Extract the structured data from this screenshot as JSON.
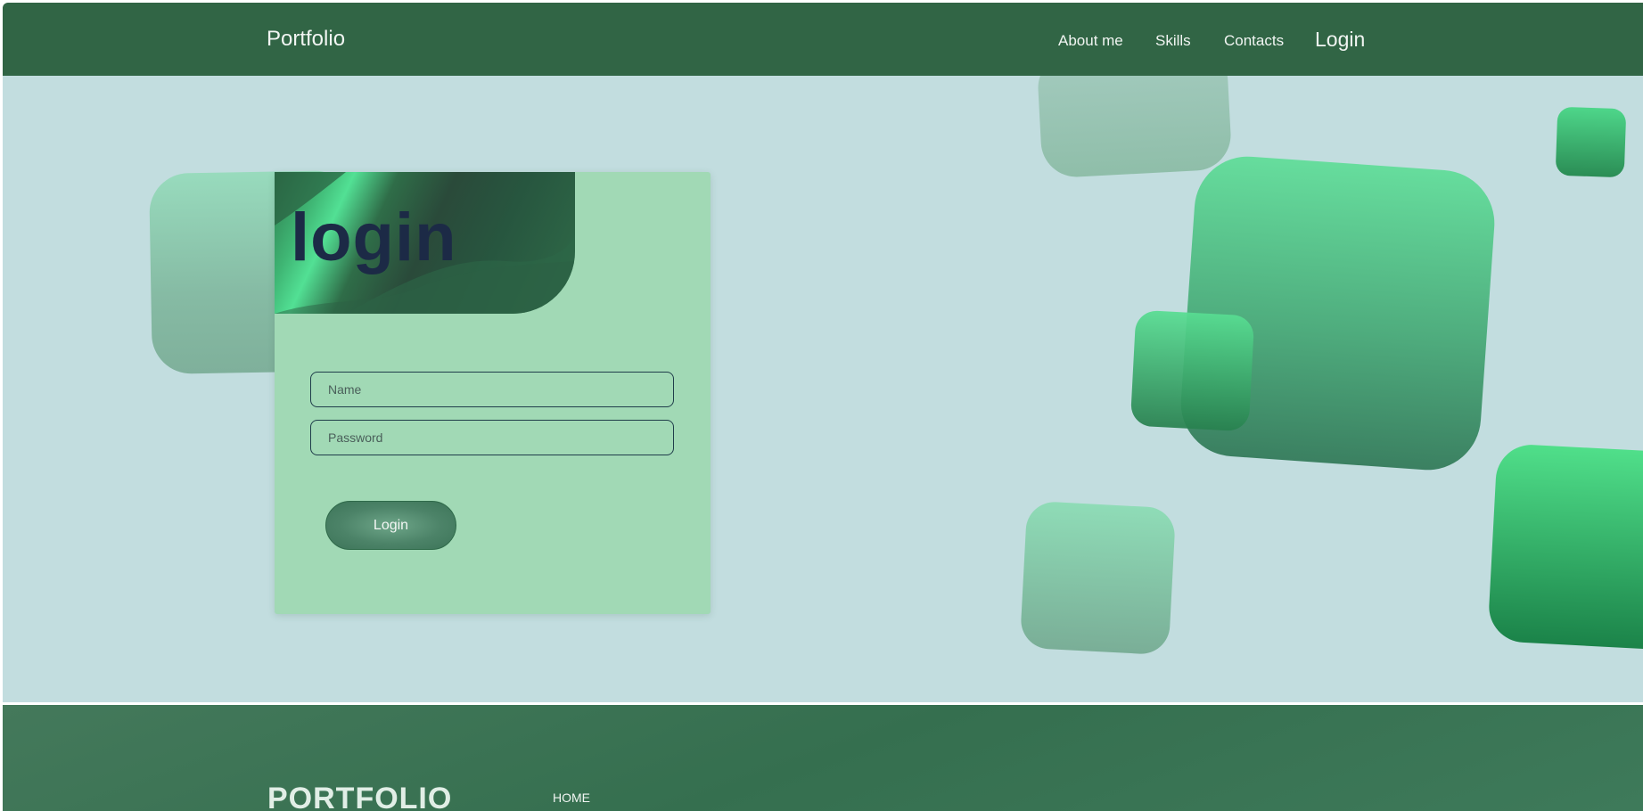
{
  "header": {
    "brand": "Portfolio",
    "nav": {
      "about": "About me",
      "skills": "Skills",
      "contacts": "Contacts",
      "login": "Login"
    }
  },
  "login_card": {
    "title": "login",
    "name_placeholder": "Name",
    "password_placeholder": "Password",
    "submit_label": "Login"
  },
  "footer": {
    "brand": "PORTFOLIO",
    "home_link": "HOME"
  },
  "colors": {
    "header_bg": "#316545",
    "main_bg": "#c2dddf",
    "card_bg": "#a1d9b5",
    "title_color": "#1c2a46",
    "accent_green": "#52e094"
  }
}
